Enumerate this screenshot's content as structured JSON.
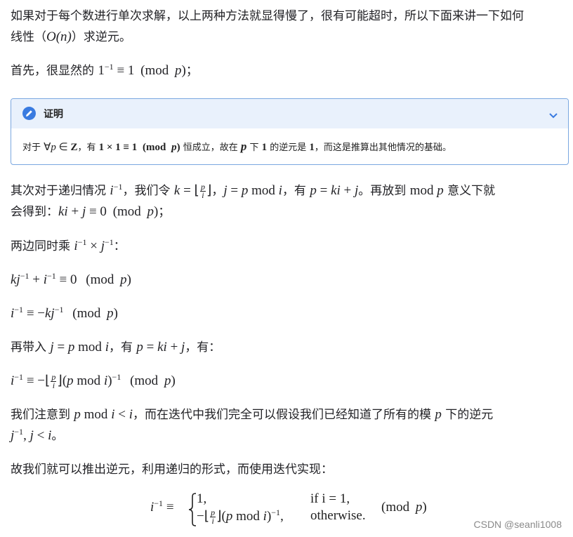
{
  "p1": {
    "line1": "如果对于每个数进行单次求解，以上两种方法就显得慢了，很有可能超时，所以下面来讲一下如何",
    "line2_prefix": "线性（",
    "line2_math": "O(n)",
    "line2_suffix": "）求逆元。"
  },
  "p2": {
    "prefix": "首先，很显然的 ",
    "suffix": "；"
  },
  "proof": {
    "title": "证明",
    "text_prefix": "对于 ",
    "text_mid1": "，有 ",
    "text_mid2": " 恒成立，故在 ",
    "text_mid3": " 下 ",
    "text_mid4": " 的逆元是 ",
    "text_suffix": "，而这是推算出其他情况的基础。"
  },
  "p3": {
    "a": "其次对于递归情况 ",
    "b": "，我们令 ",
    "c": "，",
    "d": "，有 ",
    "e": "。再放到 ",
    "f": " 意义下就",
    "line2a": "会得到：",
    "line2b": "；"
  },
  "p4": {
    "prefix": "两边同时乘 ",
    "suffix": "："
  },
  "p7": {
    "a": "再带入 ",
    "b": "，有 ",
    "c": "，有："
  },
  "p9": {
    "a": "我们注意到 ",
    "b": "，而在迭代中我们完全可以假设我们已经知道了所有的模 ",
    "c": " 下的逆元",
    "d": "。"
  },
  "p10": {
    "text": "故我们就可以推出逆元，利用递归的形式，而使用迭代实现："
  },
  "piecewise": {
    "case1": "1,",
    "cond1": "if i = 1,",
    "cond2": "otherwise."
  },
  "watermark": "CSDN @seanli1008"
}
